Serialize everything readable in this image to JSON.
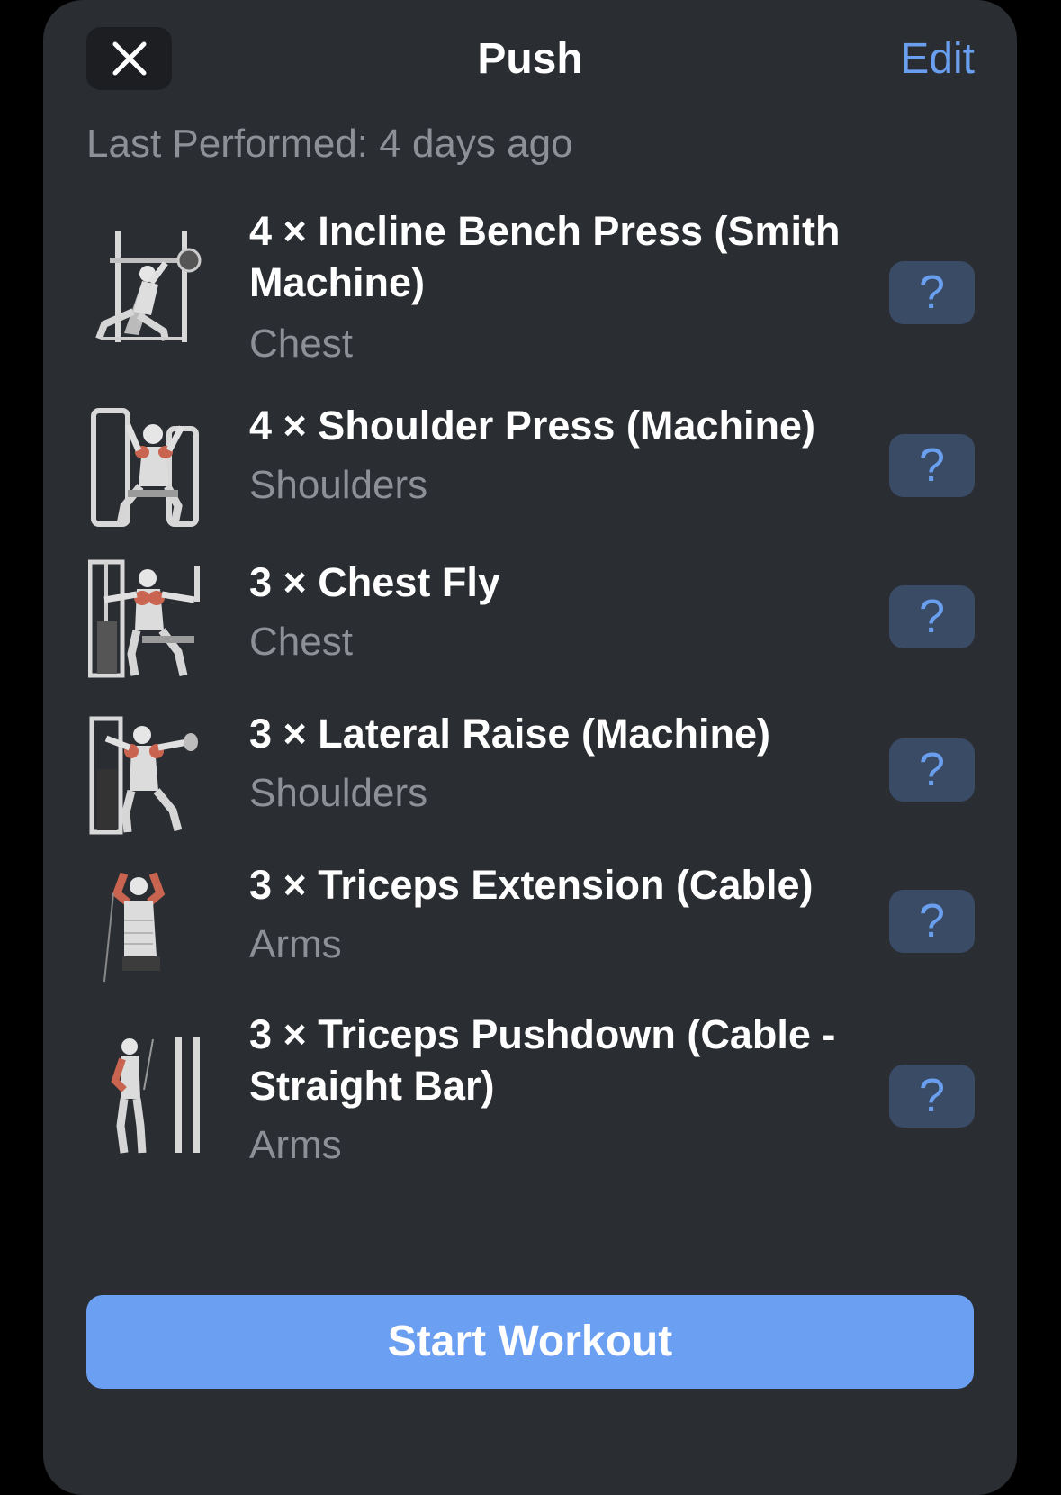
{
  "header": {
    "title": "Push",
    "edit_label": "Edit",
    "close_icon": "close-icon"
  },
  "last_performed": "Last Performed: 4 days ago",
  "exercises": [
    {
      "name": "4 × Incline Bench Press (Smith Machine)",
      "muscle": "Chest",
      "help_label": "?"
    },
    {
      "name": "4 × Shoulder Press (Machine)",
      "muscle": "Shoulders",
      "help_label": "?"
    },
    {
      "name": "3 × Chest Fly",
      "muscle": "Chest",
      "help_label": "?"
    },
    {
      "name": "3 × Lateral Raise (Machine)",
      "muscle": "Shoulders",
      "help_label": "?"
    },
    {
      "name": "3 × Triceps Extension (Cable)",
      "muscle": "Arms",
      "help_label": "?"
    },
    {
      "name": "3 × Triceps Pushdown (Cable - Straight Bar)",
      "muscle": "Arms",
      "help_label": "?"
    }
  ],
  "start_button": "Start Workout",
  "colors": {
    "accent": "#6a9ff0",
    "sheet_bg": "#2a2d32",
    "help_bg": "#3a4b66",
    "muscle_highlight": "#c8644f"
  }
}
